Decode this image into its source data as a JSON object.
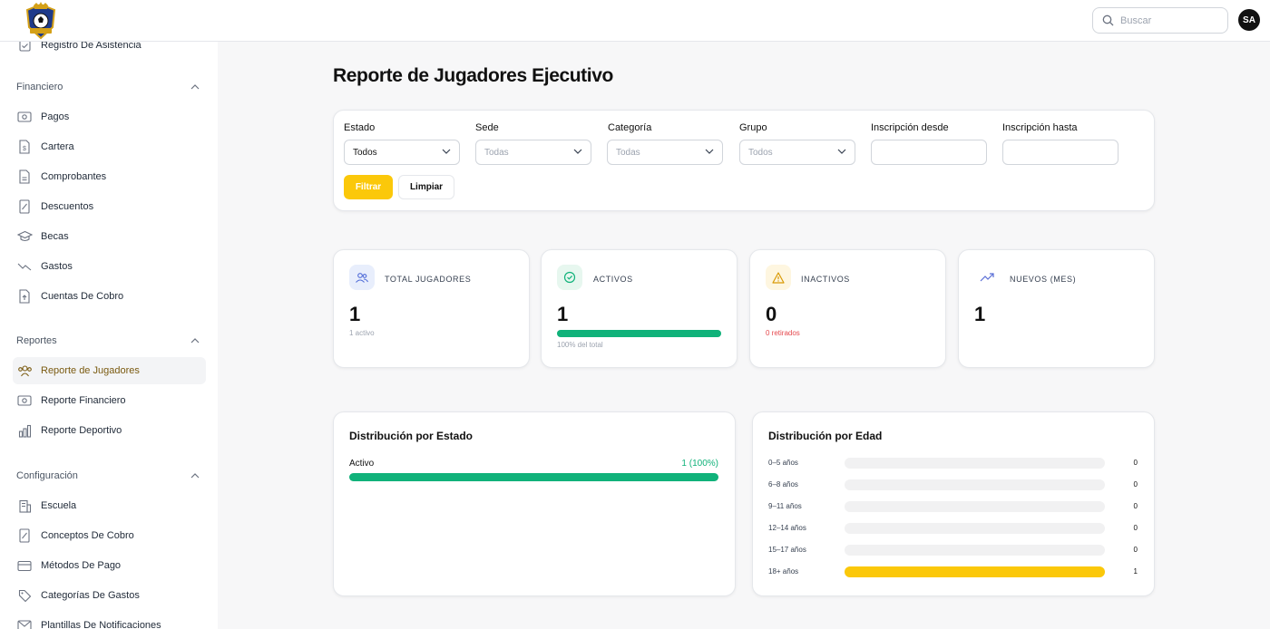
{
  "header": {
    "search_placeholder": "Buscar",
    "avatar_initials": "SA"
  },
  "sidebar": {
    "partial_item": "Registro De Asistencia",
    "sections": [
      {
        "label": "Financiero",
        "items": [
          "Pagos",
          "Cartera",
          "Comprobantes",
          "Descuentos",
          "Becas",
          "Gastos",
          "Cuentas De Cobro"
        ]
      },
      {
        "label": "Reportes",
        "items": [
          "Reporte de Jugadores",
          "Reporte Financiero",
          "Reporte Deportivo"
        ]
      },
      {
        "label": "Configuración",
        "items": [
          "Escuela",
          "Conceptos De Cobro",
          "Métodos De Pago",
          "Categorías De Gastos",
          "Plantillas De Notificaciones"
        ]
      }
    ],
    "active_item": "Reporte de Jugadores"
  },
  "page": {
    "title": "Reporte de Jugadores Ejecutivo"
  },
  "filters": {
    "estado": {
      "label": "Estado",
      "value": "Todos"
    },
    "sede": {
      "label": "Sede",
      "value": "Todas"
    },
    "categoria": {
      "label": "Categoría",
      "value": "Todas"
    },
    "grupo": {
      "label": "Grupo",
      "value": "Todos"
    },
    "desde": {
      "label": "Inscripción desde",
      "value": ""
    },
    "hasta": {
      "label": "Inscripción hasta",
      "value": ""
    },
    "filter_button": "Filtrar",
    "clear_button": "Limpiar"
  },
  "stats": {
    "total": {
      "label": "TOTAL JUGADORES",
      "value": "1",
      "sub": "1 activo"
    },
    "activos": {
      "label": "ACTIVOS",
      "value": "1",
      "sub": "100% del total",
      "progress": 1.0
    },
    "inactivos": {
      "label": "INACTIVOS",
      "value": "0",
      "sub": "0 retirados"
    },
    "nuevos": {
      "label": "NUEVOS (MES)",
      "value": "1"
    }
  },
  "estado_dist": {
    "title": "Distribución por Estado",
    "rows": [
      {
        "label": "Activo",
        "value_text": "1 (100%)",
        "fraction": 1.0
      }
    ]
  },
  "edad_dist": {
    "title": "Distribución por Edad",
    "rows": [
      {
        "label": "0–5 años",
        "value": 0
      },
      {
        "label": "6–8 años",
        "value": 0
      },
      {
        "label": "9–11 años",
        "value": 0
      },
      {
        "label": "12–14 años",
        "value": 0
      },
      {
        "label": "15–17 años",
        "value": 0
      },
      {
        "label": "18+ años",
        "value": 1
      }
    ],
    "max": 1
  },
  "colors": {
    "accent": "#fbc80a",
    "success": "#10b27a",
    "danger": "#e5484d"
  }
}
